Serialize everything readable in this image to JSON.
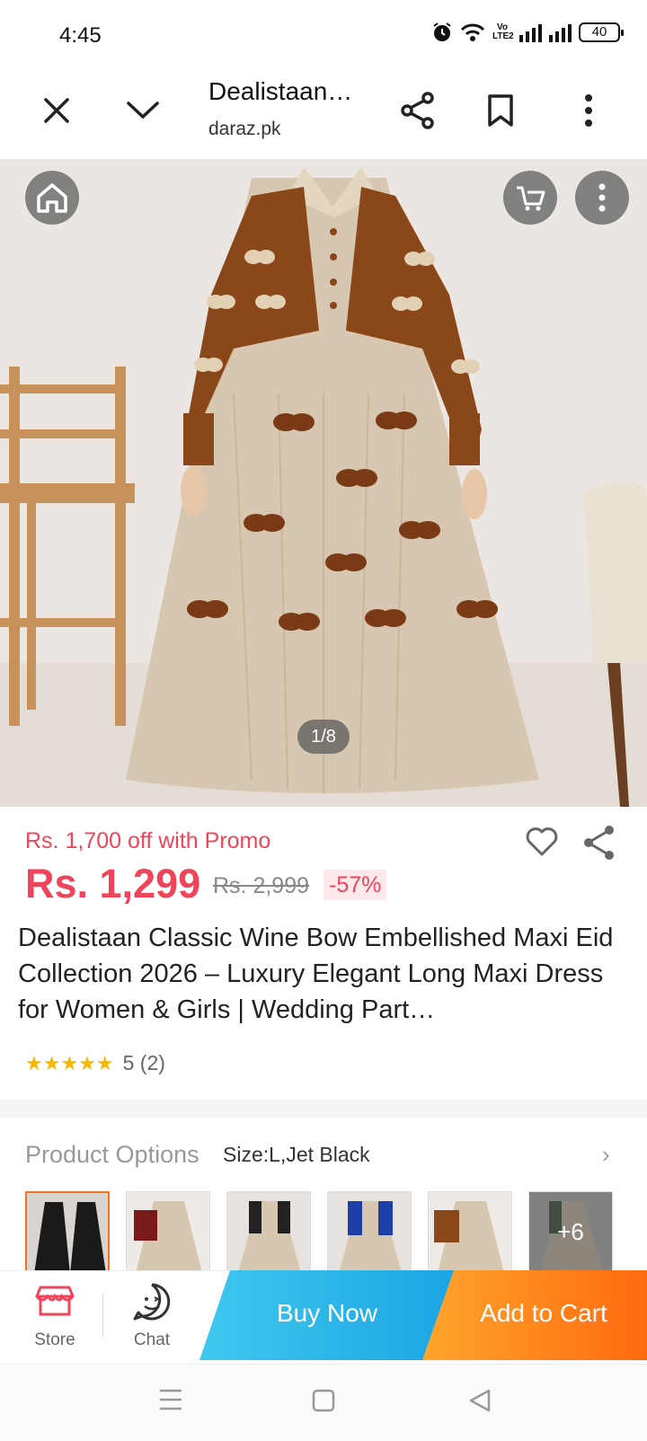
{
  "status_bar": {
    "time": "4:45",
    "volte": "Vo LTE2",
    "battery": "40"
  },
  "browser": {
    "title": "Dealistaan…",
    "url": "daraz.pk",
    "icons": [
      "close-icon",
      "chevron-down-icon",
      "share-icon",
      "bookmark-icon",
      "more-vertical-icon"
    ]
  },
  "gallery": {
    "counter": "1/8"
  },
  "product": {
    "promo": "Rs. 1,700 off with Promo",
    "price": "Rs. 1,299",
    "old_price": "Rs. 2,999",
    "discount": "-57%",
    "title": "Dealistaan Classic Wine Bow Embellished Maxi Eid Collection 2026 – Luxury Elegant Long Maxi Dress for Women & Girls | Wedding Part…",
    "rating_stars": 5,
    "rating_text": "5 (2)"
  },
  "options": {
    "label": "Product Options",
    "value": "Size:L,Jet Black",
    "more_count": "+6"
  },
  "actions": {
    "store_label": "Store",
    "chat_label": "Chat",
    "buy_now": "Buy Now",
    "add_to_cart": "Add to Cart"
  },
  "colors": {
    "price_red": "#f0445a",
    "buy_blue": "#1ca5e3",
    "cart_orange": "#ff6a10",
    "selected_border": "#f57224",
    "star": "#f6b800"
  }
}
